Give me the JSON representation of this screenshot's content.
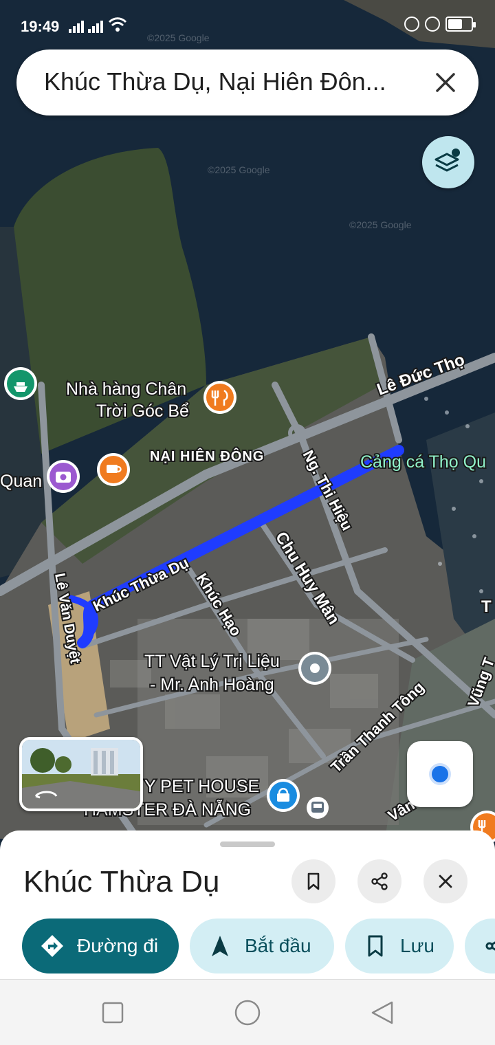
{
  "status_bar": {
    "time": "19:49"
  },
  "search": {
    "query": "Khúc Thừa Dụ, Nại Hiên Đôn..."
  },
  "map": {
    "watermark": "©2025 Google",
    "road_labels": [
      "Lê Đức Thọ",
      "Ng. Thi Hiệu",
      "Chu Huy Mân",
      "Khúc Thừa Dụ",
      "Khúc Hạo",
      "Lê Văn Duyệt",
      "Trần Thanh Tông",
      "Vân",
      "Vũng T",
      "T"
    ],
    "area_label": "NẠI HIÊN ĐÔNG",
    "poi": {
      "restaurant_line1": "Nhà hàng Chân",
      "restaurant_line2": "Trời Góc Bể",
      "port": "Cảng cá Thọ Qu",
      "photo_place": "Quan",
      "therapy_line1": "TT Vật Lý Trị Liệu",
      "therapy_line2": "- Mr. Anh Hoàng",
      "pet_line1": "Y PET HOUSE",
      "pet_line2": "HAMSTER ĐÀ NẴNG"
    },
    "colors": {
      "route": "#1f3cff",
      "land": "#3a4b33",
      "water": "#16283a",
      "road": "#8e959c"
    }
  },
  "place_sheet": {
    "title": "Khúc Thừa Dụ",
    "buttons": {
      "directions": "Đường đi",
      "start": "Bắt đầu",
      "save": "Lưu"
    }
  },
  "icons": [
    "search-clear-icon",
    "layers-icon",
    "bookmark-icon",
    "share-icon",
    "close-icon",
    "directions-icon",
    "navigate-arrow-icon",
    "save-bookmark-icon",
    "recent-apps-icon",
    "home-icon",
    "back-icon"
  ]
}
